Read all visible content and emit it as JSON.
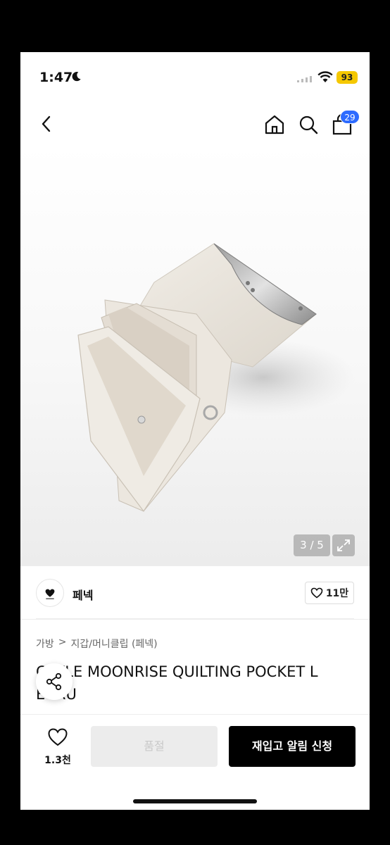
{
  "status_bar": {
    "time": "1:47",
    "battery": "93"
  },
  "nav": {
    "cart_count": "29"
  },
  "gallery": {
    "counter": "3 / 5"
  },
  "brand": {
    "name": "페넥",
    "like_count": "11만"
  },
  "breadcrumb": {
    "category": "가방",
    "separator": ">",
    "subcategory": "지갑/머니클립 (페넥)"
  },
  "product": {
    "title": "C  IKLE MOONRISE QUILTING POCKET L  ECRU"
  },
  "bottom": {
    "wish_count": "1.3천",
    "soldout_label": "품절",
    "restock_label": "재입고 알림 신청"
  },
  "colors": {
    "cart_badge": "#2d6bff",
    "battery_badge": "#f5c800",
    "primary_button": "#000000",
    "disabled_button": "#ececec"
  }
}
